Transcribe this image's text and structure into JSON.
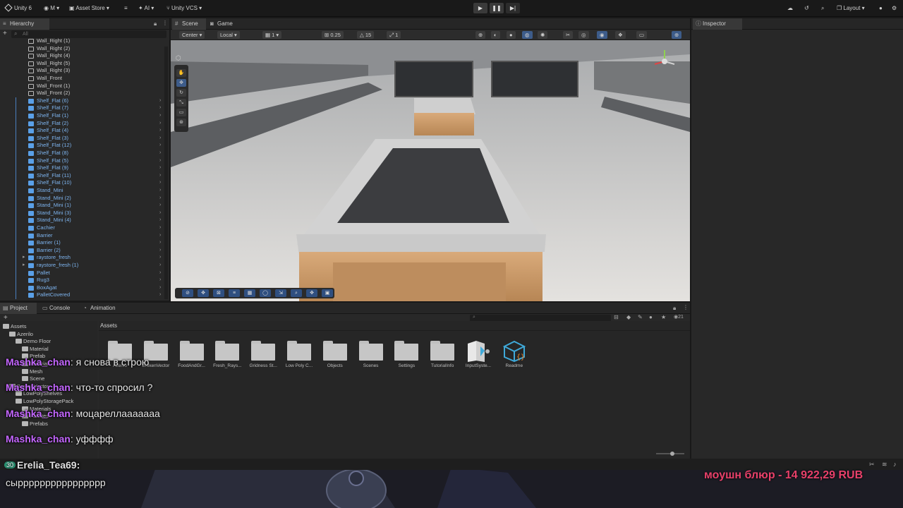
{
  "topbar": {
    "unity_label": "Unity 6",
    "account_label": "M",
    "asset_store": "Asset Store",
    "ai": "AI",
    "vcs": "Unity VCS",
    "layout": "Layout"
  },
  "hierarchy": {
    "tab": "Hierarchy",
    "search_placeholder": "All",
    "items": [
      {
        "label": "Wall_Right (1)",
        "kind": "plain"
      },
      {
        "label": "Wall_Right (2)",
        "kind": "plain"
      },
      {
        "label": "Wall_Right (4)",
        "kind": "plain"
      },
      {
        "label": "Wall_Right (5)",
        "kind": "plain"
      },
      {
        "label": "Wall_Right (3)",
        "kind": "plain"
      },
      {
        "label": "Wall_Front",
        "kind": "plain"
      },
      {
        "label": "Wall_Front (1)",
        "kind": "plain"
      },
      {
        "label": "Wall_Front (2)",
        "kind": "plain"
      },
      {
        "label": "Shelf_Flat (6)",
        "kind": "prefab"
      },
      {
        "label": "Shelf_Flat (7)",
        "kind": "prefab"
      },
      {
        "label": "Shelf_Flat (1)",
        "kind": "prefab"
      },
      {
        "label": "Shelf_Flat (2)",
        "kind": "prefab"
      },
      {
        "label": "Shelf_Flat (4)",
        "kind": "prefab"
      },
      {
        "label": "Shelf_Flat (3)",
        "kind": "prefab"
      },
      {
        "label": "Shelf_Flat (12)",
        "kind": "prefab"
      },
      {
        "label": "Shelf_Flat (8)",
        "kind": "prefab"
      },
      {
        "label": "Shelf_Flat (5)",
        "kind": "prefab"
      },
      {
        "label": "Shelf_Flat (9)",
        "kind": "prefab"
      },
      {
        "label": "Shelf_Flat (11)",
        "kind": "prefab"
      },
      {
        "label": "Shelf_Flat (10)",
        "kind": "prefab"
      },
      {
        "label": "Stand_Mini",
        "kind": "prefab"
      },
      {
        "label": "Stand_Mini (2)",
        "kind": "prefab"
      },
      {
        "label": "Stand_Mini (1)",
        "kind": "prefab"
      },
      {
        "label": "Stand_Mini (3)",
        "kind": "prefab"
      },
      {
        "label": "Stand_Mini (4)",
        "kind": "prefab"
      },
      {
        "label": "Cachier",
        "kind": "prefab"
      },
      {
        "label": "Barrier",
        "kind": "prefab"
      },
      {
        "label": "Barrier (1)",
        "kind": "prefab"
      },
      {
        "label": "Barrier (2)",
        "kind": "prefab"
      },
      {
        "label": "raystore_fresh",
        "kind": "prefab"
      },
      {
        "label": "raystore_fresh (1)",
        "kind": "prefab"
      },
      {
        "label": "Pallet",
        "kind": "prefab"
      },
      {
        "label": "Rug3",
        "kind": "prefab"
      },
      {
        "label": "BoxAgat",
        "kind": "prefab"
      },
      {
        "label": "PalletCovered",
        "kind": "prefab"
      }
    ]
  },
  "scene": {
    "tab_scene": "Scene",
    "tab_game": "Game",
    "pivot": "Center",
    "space": "Local",
    "grid_value": "1",
    "snap_value": "0.25",
    "rotate_snap": "15",
    "scale_snap": "1"
  },
  "inspector": {
    "tab": "Inspector"
  },
  "project": {
    "tab_project": "Project",
    "tab_console": "Console",
    "tab_animation": "Animation",
    "breadcrumb": "Assets",
    "hidden_count": "21",
    "tree": [
      {
        "label": "Assets",
        "depth": 0
      },
      {
        "label": "Azerilo",
        "depth": 1
      },
      {
        "label": "Demo Floor",
        "depth": 2
      },
      {
        "label": "Material",
        "depth": 3
      },
      {
        "label": "Prefab",
        "depth": 3
      },
      {
        "label": "Material",
        "depth": 3
      },
      {
        "label": "Mesh",
        "depth": 3
      },
      {
        "label": "Scene",
        "depth": 3
      },
      {
        "label": "BrokenVector",
        "depth": 1
      },
      {
        "label": "LowPolyShelves",
        "depth": 2
      },
      {
        "label": "LowPolyStoragePack",
        "depth": 2
      },
      {
        "label": "Materials",
        "depth": 3
      },
      {
        "label": "Palettes",
        "depth": 3
      },
      {
        "label": "Prefabs",
        "depth": 3
      }
    ],
    "assets": [
      {
        "label": "Azerilo",
        "type": "folder"
      },
      {
        "label": "BrokenVector",
        "type": "folder"
      },
      {
        "label": "FoodAndGr...",
        "type": "folder"
      },
      {
        "label": "Fresh_Rays...",
        "type": "folder"
      },
      {
        "label": "Gridness St...",
        "type": "folder"
      },
      {
        "label": "Low Poly C...",
        "type": "folder"
      },
      {
        "label": "Objects",
        "type": "folder"
      },
      {
        "label": "Scenes",
        "type": "folder"
      },
      {
        "label": "Settings",
        "type": "folder"
      },
      {
        "label": "TutorialInfo",
        "type": "folder"
      },
      {
        "label": "InputSyste...",
        "type": "input"
      },
      {
        "label": "Readme",
        "type": "readme"
      }
    ]
  },
  "chat": [
    {
      "user": "Mashka_chan",
      "text": ": я снова в строю"
    },
    {
      "user": "Mashka_chan",
      "text": ": что-то спросил ?"
    },
    {
      "user": "Mashka_chan",
      "text": ": моцареллааааааа"
    },
    {
      "user": "Mashka_chan",
      "text": ": уфффф"
    }
  ],
  "chat_last": {
    "badge": "30",
    "user": "Erelia_Tea69:",
    "text": "сырррррррррррррррр"
  },
  "donation": "моушн блюр - 14 922,29 RUB",
  "colors": {
    "prefab": "#7eb5f0",
    "plain": "#c8c8c8",
    "chat_user": "#c466ff",
    "donation": "#e8406a",
    "active_tool": "#3d5c8a"
  }
}
